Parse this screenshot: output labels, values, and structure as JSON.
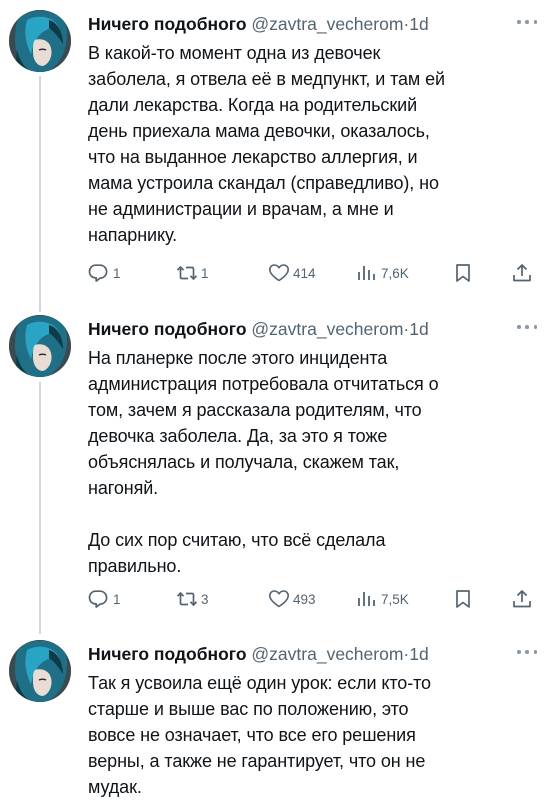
{
  "tweets": [
    {
      "author_name": "Ничего подобного",
      "handle": "@zavtra_vecherom",
      "separator": "·",
      "time": "1d",
      "text": "В какой-то момент одна из девочек\nзаболела, я отвела её в медпункт, и там ей\nдали лекарства. Когда на родительский\nдень приехала мама девочки, оказалось,\nчто на выданное лекарство аллергия, и\nмама устроила скандал (справедливо), но\nне администрации и врачам, а мне и\nнапарнику.",
      "replies": "1",
      "retweets": "1",
      "likes": "414",
      "views": "7,6K"
    },
    {
      "author_name": "Ничего подобного",
      "handle": "@zavtra_vecherom",
      "separator": "·",
      "time": "1d",
      "text": "На планерке после этого инцидента\nадминистрация потребовала отчитаться о\nтом, зачем я рассказала родителям, что\nдевочка заболела. Да, за это я тоже\nобъяснялась и получала, скажем так,\nнагоняй.\n\nДо сих пор считаю, что всё сделала\nправильно.",
      "replies": "1",
      "retweets": "3",
      "likes": "493",
      "views": "7,5K"
    },
    {
      "author_name": "Ничего подобного",
      "handle": "@zavtra_vecherom",
      "separator": "·",
      "time": "1d",
      "text": "Так я усвоила ещё один урок: если кто-то\nстарше и выше вас по положению, это\nвовсе не означает, что все его решения\nверны, а также не гарантирует, что он не\nмудак."
    }
  ],
  "icons": {
    "reply": "reply-icon",
    "retweet": "retweet-icon",
    "like": "heart-icon",
    "views": "views-chart-icon",
    "bookmark": "bookmark-icon",
    "share": "share-icon",
    "more": "more-dots-icon"
  },
  "colors": {
    "text": "#0f1419",
    "secondary": "#536471",
    "thread_line": "#cfd9de"
  }
}
